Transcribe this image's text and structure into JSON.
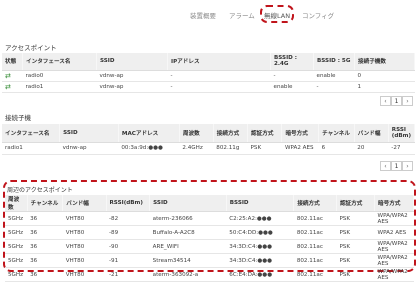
{
  "nav": {
    "tabs": [
      {
        "label": "装置概要"
      },
      {
        "label": "アラーム"
      },
      {
        "label": "コンフィグ"
      },
      {
        "label": "無線LAN"
      }
    ]
  },
  "access_points": {
    "title": "アクセスポイント",
    "headers": [
      "状態",
      "インタフェース名",
      "SSID",
      "IPアドレス",
      "BSSID : 2.4G",
      "BSSID : 5G",
      "接続子機数"
    ],
    "rows": [
      {
        "status_icon": "arrows-icon",
        "name": "radio0",
        "ssid": "vdnw-ap",
        "ip": "-",
        "bssid24": "-",
        "bssid5": "enable",
        "clients": "0"
      },
      {
        "status_icon": "arrows-icon",
        "name": "radio1",
        "ssid": "vdnw-ap",
        "ip": "-",
        "bssid24": "enable",
        "bssid5": "-",
        "clients": "1"
      }
    ],
    "pager": {
      "prev": "‹",
      "page": "1",
      "next": "›"
    }
  },
  "clients": {
    "title": "接続子機",
    "headers": [
      "インタフェース名",
      "SSID",
      "MACアドレス",
      "周波数",
      "接続方式",
      "認証方式",
      "暗号方式",
      "チャンネル",
      "バンド幅",
      "RSSI (dBm)"
    ],
    "rows": [
      {
        "name": "radio1",
        "ssid": "vdnw-ap",
        "mac": "00:3a:9d:●●●",
        "freq": "2.4GHz",
        "mode": "802.11g",
        "auth": "PSK",
        "enc": "WPA2 AES",
        "channel": "6",
        "bw": "20",
        "rssi": "-27"
      }
    ],
    "pager": {
      "prev": "‹",
      "page": "1",
      "next": "›"
    }
  },
  "nearby": {
    "title": "周辺のアクセスポイント",
    "headers": [
      "周波数",
      "チャンネル",
      "バンド幅",
      "RSSI(dBm)",
      "SSID",
      "BSSID",
      "接続方式",
      "認証方式",
      "暗号方式"
    ],
    "rows": [
      {
        "freq": "5GHz",
        "ch": "36",
        "bw": "VHT80",
        "rssi": "-82",
        "ssid": "aterm-236066",
        "bssid": "C2:25:A2:●●●",
        "mode": "802.11ac",
        "auth": "PSK",
        "enc": "WPA/WPA2 AES"
      },
      {
        "freq": "5GHz",
        "ch": "36",
        "bw": "VHT80",
        "rssi": "-89",
        "ssid": "Buffalo-A-A2C8",
        "bssid": "50:C4:DD:●●●",
        "mode": "802.11ac",
        "auth": "PSK",
        "enc": "WPA2 AES"
      },
      {
        "freq": "5GHz",
        "ch": "36",
        "bw": "VHT80",
        "rssi": "-90",
        "ssid": "ARE_WIFI",
        "bssid": "34:3D:C4:●●●",
        "mode": "802.11ac",
        "auth": "PSK",
        "enc": "WPA/WPA2 AES"
      },
      {
        "freq": "5GHz",
        "ch": "36",
        "bw": "VHT80",
        "rssi": "-91",
        "ssid": "Stream34514",
        "bssid": "34:3D:C4:●●●",
        "mode": "802.11ac",
        "auth": "PSK",
        "enc": "WPA/WPA2 AES"
      },
      {
        "freq": "5GHz",
        "ch": "36",
        "bw": "VHT80",
        "rssi": "-21",
        "ssid": "aterm-363092-a",
        "bssid": "6C:E4:DA:●●●",
        "mode": "802.11ac",
        "auth": "PSK",
        "enc": "WPA/WPA2 AES"
      }
    ]
  }
}
